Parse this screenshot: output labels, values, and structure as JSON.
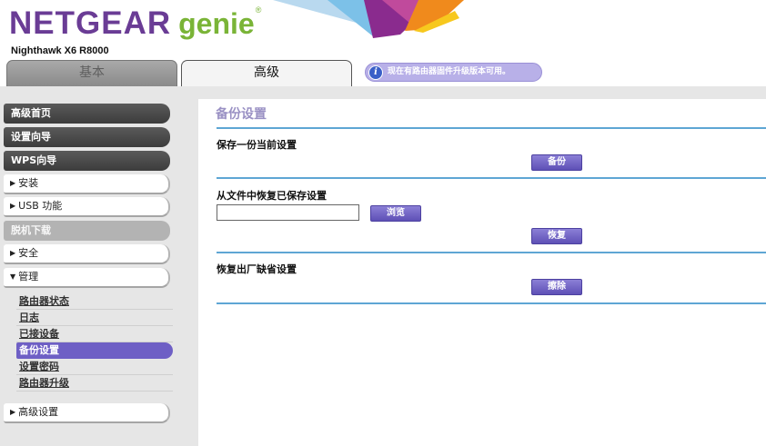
{
  "header": {
    "logo_netgear": "NETGEAR",
    "logo_genie": "genie",
    "logo_tm": "®",
    "model": "Nighthawk X6 R8000",
    "tabs": [
      {
        "label": "基本",
        "active": false
      },
      {
        "label": "高级",
        "active": true
      }
    ],
    "notice": {
      "icon": "info-icon",
      "icon_glyph": "i",
      "text": "现在有路由器固件升级版本可用。"
    },
    "colors": {
      "brand_purple": "#6a3c95",
      "genie_green": "#7ab437",
      "accent_blue": "#5ea6d4"
    }
  },
  "sidebar": {
    "main_items": [
      {
        "label": "高级首页"
      },
      {
        "label": "设置向导"
      },
      {
        "label": "WPS向导"
      }
    ],
    "expand_items": {
      "install": {
        "label": "安装",
        "icon": "triangle-right-icon",
        "glyph": "▶"
      },
      "usb": {
        "label": "USB 功能",
        "icon": "triangle-right-icon",
        "glyph": "▶"
      },
      "offline": {
        "label": "脱机下载"
      },
      "security": {
        "label": "安全",
        "icon": "triangle-right-icon",
        "glyph": "▶"
      },
      "admin": {
        "label": "管理",
        "icon": "triangle-down-icon",
        "glyph": "▼"
      },
      "advanced": {
        "label": "高级设置",
        "icon": "triangle-right-icon",
        "glyph": "▶"
      }
    },
    "admin_subitems": [
      {
        "label": "路由器状态",
        "active": false
      },
      {
        "label": "日志",
        "active": false
      },
      {
        "label": "已接设备",
        "active": false
      },
      {
        "label": "备份设置",
        "active": true
      },
      {
        "label": "设置密码",
        "active": false
      },
      {
        "label": "路由器升级",
        "active": false
      }
    ]
  },
  "main": {
    "title": "备份设置",
    "save_section": {
      "label": "保存一份当前设置",
      "button": "备份"
    },
    "restore_section": {
      "label": "从文件中恢复已保存设置",
      "file_value": "",
      "browse_button": "浏览",
      "restore_button": "恢复"
    },
    "factory_section": {
      "label": "恢复出厂缺省设置",
      "button": "擦除"
    }
  }
}
